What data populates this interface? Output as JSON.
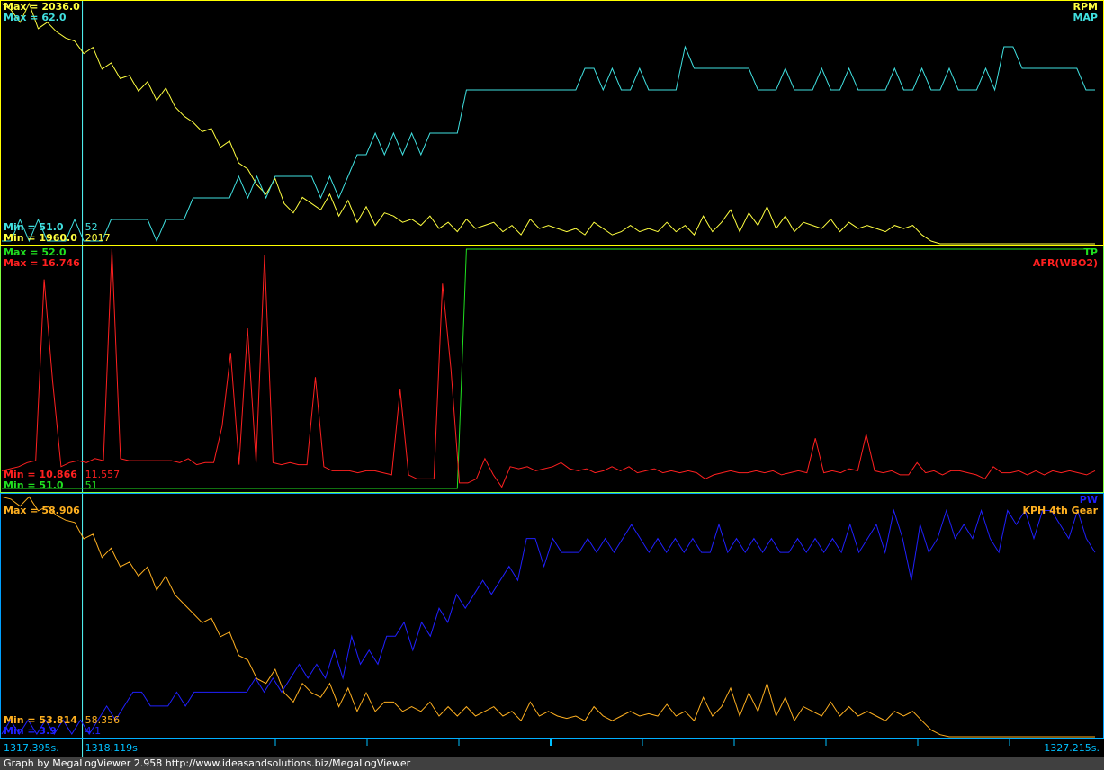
{
  "footer_text": "Graph by MegaLogViewer 2.958 http://www.ideasandsolutions.biz/MegaLogViewer",
  "time_axis": {
    "start_label": "1317.395s.",
    "cursor_label": "1318.119s",
    "end_label": "1327.215s.",
    "start": 1317.395,
    "end": 1327.215,
    "cursor": 1318.119,
    "color": "#00c0ff"
  },
  "chart_data": [
    {
      "type": "line",
      "panel": "top",
      "border_color": "#ffff00",
      "cursor_color": "#55ffff",
      "series": [
        {
          "name": "RPM",
          "color": "#ffff40",
          "max_label": "Max = 2036.0",
          "min_label": "Min = 1960.0",
          "cursor_value": "2017",
          "min": 1960,
          "max": 2036,
          "values": [
            2036,
            2034,
            2030,
            2036,
            2028,
            2030,
            2027,
            2025,
            2024,
            2020,
            2022,
            2015,
            2017,
            2012,
            2013,
            2008,
            2011,
            2005,
            2009,
            2003,
            2000,
            1998,
            1995,
            1996,
            1990,
            1992,
            1985,
            1983,
            1978,
            1975,
            1980,
            1972,
            1969,
            1974,
            1972,
            1970,
            1975,
            1968,
            1973,
            1966,
            1971,
            1965,
            1969,
            1968,
            1966,
            1967,
            1965,
            1968,
            1964,
            1966,
            1963,
            1967,
            1964,
            1965,
            1966,
            1963,
            1965,
            1962,
            1967,
            1964,
            1965,
            1964,
            1963,
            1964,
            1962,
            1966,
            1964,
            1962,
            1963,
            1965,
            1963,
            1964,
            1963,
            1966,
            1963,
            1965,
            1962,
            1968,
            1963,
            1966,
            1970,
            1963,
            1969,
            1965,
            1971,
            1964,
            1968,
            1963,
            1966,
            1965,
            1964,
            1967,
            1963,
            1966,
            1964,
            1965,
            1964,
            1963,
            1965,
            1964,
            1965,
            1962,
            1960,
            1959,
            1958,
            1955,
            1957,
            1953,
            1951,
            1954,
            1950,
            1951,
            1949,
            1948,
            1949,
            1947,
            1948,
            1946,
            1946,
            1945,
            1947
          ]
        },
        {
          "name": "MAP",
          "color": "#40e0e0",
          "max_label": "Max = 62.0",
          "min_label": "Min = 51.0",
          "cursor_value": "52",
          "min": 51,
          "max": 62,
          "values": [
            51,
            51,
            52,
            51,
            52,
            51,
            51,
            51,
            52,
            51,
            51,
            51,
            52,
            52,
            52,
            52,
            52,
            51,
            52,
            52,
            52,
            53,
            53,
            53,
            53,
            53,
            54,
            53,
            54,
            53,
            54,
            54,
            54,
            54,
            54,
            53,
            54,
            53,
            54,
            55,
            55,
            56,
            55,
            56,
            55,
            56,
            55,
            56,
            56,
            56,
            56,
            58,
            58,
            58,
            58,
            58,
            58,
            58,
            58,
            58,
            58,
            58,
            58,
            58,
            59,
            59,
            58,
            59,
            58,
            58,
            59,
            58,
            58,
            58,
            58,
            60,
            59,
            59,
            59,
            59,
            59,
            59,
            59,
            58,
            58,
            58,
            59,
            58,
            58,
            58,
            59,
            58,
            58,
            59,
            58,
            58,
            58,
            58,
            59,
            58,
            58,
            59,
            58,
            58,
            59,
            58,
            58,
            58,
            59,
            58,
            60,
            60,
            59,
            59,
            59,
            59,
            59,
            59,
            59,
            58,
            58
          ]
        }
      ]
    },
    {
      "type": "line",
      "panel": "middle",
      "border_color": "#80ff40",
      "cursor_color": "#55ffff",
      "series": [
        {
          "name": "TP",
          "color": "#20e020",
          "max_label": "Max = 52.0",
          "min_label": "Min = 51.0",
          "cursor_value": "51",
          "min": 51,
          "max": 52,
          "values": [
            51,
            51,
            51,
            51,
            51,
            51,
            51,
            51,
            51,
            51,
            51,
            51,
            51,
            51,
            51,
            51,
            51,
            51,
            51,
            51,
            51,
            51,
            51,
            51,
            51,
            51,
            51,
            51,
            51,
            51,
            51,
            51,
            51,
            51,
            51,
            51,
            51,
            51,
            51,
            51,
            51,
            51,
            51,
            51,
            51,
            51,
            51,
            51,
            51,
            51,
            51,
            52,
            52,
            52,
            52,
            52,
            52,
            52,
            52,
            52,
            52,
            52,
            52,
            52,
            52,
            52,
            52,
            52,
            52,
            52,
            52,
            52,
            52,
            52,
            52,
            52,
            52,
            52,
            52,
            52,
            52,
            52,
            52,
            52,
            52,
            52,
            52,
            52,
            52,
            52,
            52,
            52,
            52,
            52,
            52,
            52,
            52,
            52,
            52,
            52,
            52,
            52,
            52,
            52,
            52,
            52,
            52,
            52,
            52,
            52,
            52,
            52,
            52,
            52,
            52,
            52,
            52,
            52,
            52,
            52,
            52
          ]
        },
        {
          "name": "AFR(WBO2)",
          "color": "#ff2020",
          "max_label": "Max = 16.746",
          "min_label": "Min = 10.866",
          "cursor_value": "11.557",
          "min": 10.866,
          "max": 16.746,
          "values": [
            11.3,
            11.35,
            11.4,
            11.5,
            11.55,
            16.0,
            13.5,
            11.4,
            11.5,
            11.55,
            11.5,
            11.6,
            11.55,
            16.75,
            11.6,
            11.55,
            11.55,
            11.55,
            11.55,
            11.55,
            11.55,
            11.5,
            11.6,
            11.45,
            11.5,
            11.5,
            12.4,
            14.2,
            11.45,
            14.8,
            11.5,
            16.6,
            11.5,
            11.45,
            11.5,
            11.45,
            11.45,
            13.6,
            11.4,
            11.3,
            11.3,
            11.3,
            11.25,
            11.3,
            11.3,
            11.25,
            11.2,
            13.3,
            11.2,
            11.1,
            11.1,
            11.1,
            15.9,
            13.8,
            11.0,
            11.0,
            11.1,
            11.6,
            11.2,
            10.9,
            11.4,
            11.35,
            11.4,
            11.3,
            11.35,
            11.4,
            11.5,
            11.35,
            11.3,
            11.35,
            11.25,
            11.3,
            11.4,
            11.3,
            11.4,
            11.25,
            11.3,
            11.35,
            11.25,
            11.3,
            11.25,
            11.3,
            11.25,
            11.1,
            11.2,
            11.25,
            11.3,
            11.25,
            11.25,
            11.3,
            11.25,
            11.3,
            11.2,
            11.25,
            11.3,
            11.25,
            12.1,
            11.25,
            11.3,
            11.25,
            11.35,
            11.3,
            12.2,
            11.3,
            11.25,
            11.3,
            11.2,
            11.2,
            11.5,
            11.25,
            11.3,
            11.2,
            11.3,
            11.3,
            11.25,
            11.2,
            11.1,
            11.4,
            11.25,
            11.25,
            11.3,
            11.2,
            11.3,
            11.2,
            11.3,
            11.25,
            11.3,
            11.25,
            11.2,
            11.3
          ]
        }
      ]
    },
    {
      "type": "line",
      "panel": "bottom",
      "border_color": "#00a0ff",
      "cursor_color": "#55ffff",
      "series": [
        {
          "name": "PW",
          "color": "#2020ff",
          "max_label": "",
          "min_label": "Min = 3.9",
          "cursor_value": "4.1",
          "min": 3.9,
          "max": 5.6,
          "values": [
            3.9,
            4.0,
            3.9,
            4.0,
            3.9,
            4.0,
            3.9,
            4.0,
            3.9,
            4.0,
            3.9,
            4.0,
            4.1,
            4.0,
            4.1,
            4.2,
            4.2,
            4.1,
            4.1,
            4.1,
            4.2,
            4.1,
            4.2,
            4.2,
            4.2,
            4.2,
            4.2,
            4.2,
            4.2,
            4.3,
            4.2,
            4.3,
            4.2,
            4.3,
            4.4,
            4.3,
            4.4,
            4.3,
            4.5,
            4.3,
            4.6,
            4.4,
            4.5,
            4.4,
            4.6,
            4.6,
            4.7,
            4.5,
            4.7,
            4.6,
            4.8,
            4.7,
            4.9,
            4.8,
            4.9,
            5.0,
            4.9,
            5.0,
            5.1,
            5.0,
            5.3,
            5.3,
            5.1,
            5.3,
            5.2,
            5.2,
            5.2,
            5.3,
            5.2,
            5.3,
            5.2,
            5.3,
            5.4,
            5.3,
            5.2,
            5.3,
            5.2,
            5.3,
            5.2,
            5.3,
            5.2,
            5.2,
            5.4,
            5.2,
            5.3,
            5.2,
            5.3,
            5.2,
            5.3,
            5.2,
            5.2,
            5.3,
            5.2,
            5.3,
            5.2,
            5.3,
            5.2,
            5.4,
            5.2,
            5.3,
            5.4,
            5.2,
            5.5,
            5.3,
            5.0,
            5.4,
            5.2,
            5.3,
            5.5,
            5.3,
            5.4,
            5.3,
            5.5,
            5.3,
            5.2,
            5.5,
            5.4,
            5.5,
            5.3,
            5.5,
            5.5,
            5.4,
            5.3,
            5.5,
            5.3,
            5.2
          ]
        },
        {
          "name": "KPH 4th Gear",
          "color": "#ffb020",
          "max_label": "Max = 58.906",
          "min_label": "Min = 53.814",
          "cursor_value": "58.356",
          "min": 53.814,
          "max": 58.906,
          "values": [
            58.9,
            58.85,
            58.7,
            58.9,
            58.6,
            58.7,
            58.5,
            58.4,
            58.35,
            58.0,
            58.1,
            57.6,
            57.8,
            57.4,
            57.5,
            57.2,
            57.4,
            56.9,
            57.2,
            56.8,
            56.6,
            56.4,
            56.2,
            56.3,
            55.9,
            56.0,
            55.5,
            55.4,
            55.0,
            54.9,
            55.2,
            54.7,
            54.5,
            54.9,
            54.7,
            54.6,
            54.9,
            54.4,
            54.8,
            54.3,
            54.7,
            54.3,
            54.5,
            54.5,
            54.3,
            54.4,
            54.3,
            54.5,
            54.2,
            54.4,
            54.2,
            54.4,
            54.2,
            54.3,
            54.4,
            54.2,
            54.3,
            54.1,
            54.5,
            54.2,
            54.3,
            54.2,
            54.15,
            54.2,
            54.1,
            54.4,
            54.2,
            54.1,
            54.2,
            54.3,
            54.2,
            54.25,
            54.2,
            54.45,
            54.2,
            54.3,
            54.1,
            54.6,
            54.2,
            54.4,
            54.8,
            54.2,
            54.7,
            54.3,
            54.9,
            54.2,
            54.6,
            54.1,
            54.4,
            54.3,
            54.2,
            54.5,
            54.2,
            54.4,
            54.2,
            54.3,
            54.2,
            54.1,
            54.3,
            54.2,
            54.3,
            54.1,
            53.9,
            53.8,
            53.7,
            53.4,
            53.6,
            53.2,
            53.0,
            53.3,
            52.9,
            53.0,
            52.8,
            52.7,
            52.8,
            52.6,
            52.7,
            52.5,
            52.5,
            52.4,
            52.6
          ]
        }
      ]
    }
  ]
}
